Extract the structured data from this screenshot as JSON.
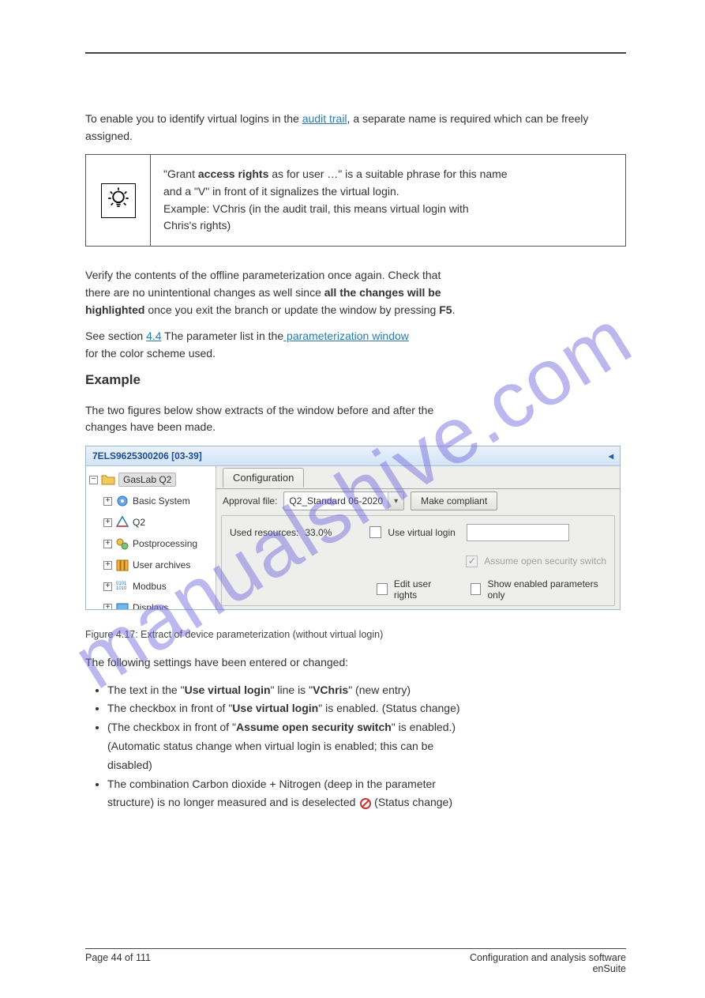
{
  "header_rule": true,
  "intro": {
    "line1_pre": "To enable you to identify virtual logins in the ",
    "line1_link": "audit trail",
    "line1_post": ", a separate name is",
    "line2": " required which can be freely assigned."
  },
  "tip": {
    "l1_pre": "\"Grant ",
    "l1_bold": "access rights",
    "l1_post": " as for user …\" is a suitable phrase for this name",
    "l2": "and a \"V\" in front of it signalizes the virtual login.",
    "l3": "Example: VChris (in the audit trail, this means virtual login with",
    "l4": "Chris's rights)"
  },
  "para2": {
    "l1": "Verify the contents of the offline parameterization once again. Check that",
    "l2_pre": "there are no unintentional changes as well since ",
    "l2_bold": "all the changes will be",
    "l3_bold_pre": "highlighted",
    "l3_mid": " once you exit the branch or update the window by pressing",
    "l3_bold2": " F5",
    "l3_end": "."
  },
  "section_link_pre": "section ",
  "section_link": "4.4",
  "section_post_pre": " The parameter list in the",
  "section_post_link": " parameterization",
  "section_post_link2": " window",
  "section_end": " for the color scheme used.",
  "closing1": "The two figures below show extracts of the window before and after the",
  "closing2": "changes have been made.",
  "shot": {
    "title": "7ELS9625300206 [03-39]",
    "tree": {
      "root": "GasLab Q2",
      "items": [
        "Basic System",
        "Q2",
        "Postprocessing",
        "User archives",
        "Modbus",
        "Displays"
      ]
    },
    "tab": "Configuration",
    "approval_label": "Approval file:",
    "approval_value": "Q2_Standard 06-2020",
    "make_compliant": "Make compliant",
    "used_resources_label": "Used resources:",
    "used_resources_value": "33.0%",
    "use_virtual_login": "Use virtual login",
    "assume_open": "Assume open security switch",
    "edit_rights": "Edit user rights",
    "show_enabled": "Show enabled parameters only"
  },
  "fig_caption": "Figure 4.17: Extract of device parameterization (without virtual login)",
  "after_fig": "The following settings have been entered or changed:",
  "bullets": {
    "b1_pre": "The text in the ",
    "b1_quote": "Use virtual login",
    "b1_post": " line is ",
    "b1_quote2": "VChris",
    "b1_end": " (new entry)",
    "b2_pre": "The checkbox in front of ",
    "b2_quote": "Use virtual login",
    "b2_post": " is enabled. (Status change)",
    "b3_pre": "(The checkbox in front of ",
    "b3_quote": "Assume open security switch",
    "b3_post": " is enabled.)",
    "b3_sub": "(Automatic status change when virtual login is enabled; this can be",
    "b3_sub2": "disabled)",
    "b4_pre": "The combination Carbon dioxide + Nitrogen (deep in the parameter",
    "b4_mid": "structure) is no longer measured and is deselected ",
    "b4_post": " (Status change)"
  },
  "watermark": "manualshive.com",
  "footer": {
    "left": "Page 44 of 111",
    "right_line1": "Configuration and analysis software",
    "right_line2": "enSuite"
  }
}
